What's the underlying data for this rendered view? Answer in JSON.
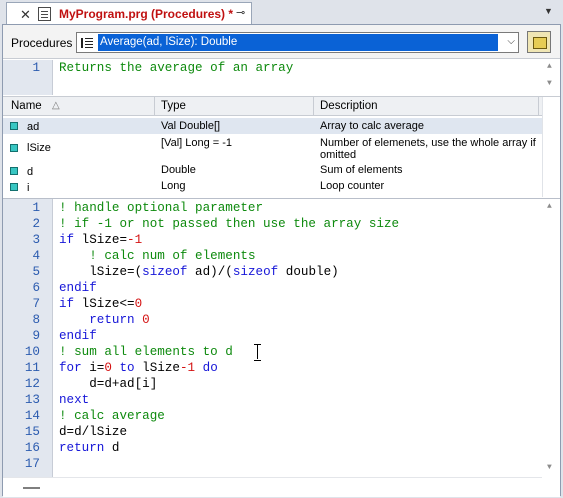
{
  "tab": {
    "close_glyph": "✕",
    "title": "MyProgram.prg (Procedures)  *",
    "pin_glyph": "⊸",
    "menu_glyph": "▼"
  },
  "procedures": {
    "label": "Procedures :",
    "selected": "Average(ad, lSize): Double",
    "dropdown_glyph": "⌵"
  },
  "description": {
    "line_number": "1",
    "text": "Returns the average of an array"
  },
  "grid": {
    "headers": [
      "Name",
      "Type",
      "Description"
    ],
    "rows": [
      {
        "name": "ad",
        "type": "Val Double[]",
        "description": "Array to calc average"
      },
      {
        "name": "lSize",
        "type": "[Val] Long = -1",
        "description": "Number of elemenets, use the whole array if omitted"
      },
      {
        "name": "d",
        "type": "Double",
        "description": "Sum of elements"
      },
      {
        "name": "i",
        "type": "Long",
        "description": "Loop counter"
      }
    ]
  },
  "code": {
    "line_numbers": [
      "1",
      "2",
      "3",
      "4",
      "5",
      "6",
      "7",
      "8",
      "9",
      "10",
      "11",
      "12",
      "13",
      "14",
      "15",
      "16",
      "17"
    ],
    "lines": [
      [
        {
          "t": "! handle optional parameter",
          "c": "cm"
        }
      ],
      [
        {
          "t": "! if -1 or not passed then use the array size",
          "c": "cm"
        }
      ],
      [
        {
          "t": "if",
          "c": "kw"
        },
        {
          "t": " lSize=",
          "c": ""
        },
        {
          "t": "-1",
          "c": "num"
        }
      ],
      [
        {
          "t": "    ",
          "c": ""
        },
        {
          "t": "! calc num of elements",
          "c": "cm"
        }
      ],
      [
        {
          "t": "    lSize=(",
          "c": ""
        },
        {
          "t": "sizeof",
          "c": "kw"
        },
        {
          "t": " ad)/(",
          "c": ""
        },
        {
          "t": "sizeof",
          "c": "kw"
        },
        {
          "t": " double)",
          "c": ""
        }
      ],
      [
        {
          "t": "endif",
          "c": "kw"
        }
      ],
      [
        {
          "t": "if",
          "c": "kw"
        },
        {
          "t": " lSize<=",
          "c": ""
        },
        {
          "t": "0",
          "c": "num"
        }
      ],
      [
        {
          "t": "    ",
          "c": ""
        },
        {
          "t": "return",
          "c": "kw"
        },
        {
          "t": " ",
          "c": ""
        },
        {
          "t": "0",
          "c": "num"
        }
      ],
      [
        {
          "t": "endif",
          "c": "kw"
        }
      ],
      [
        {
          "t": "! sum all elements to d",
          "c": "cm"
        }
      ],
      [
        {
          "t": "for",
          "c": "kw"
        },
        {
          "t": " i=",
          "c": ""
        },
        {
          "t": "0",
          "c": "num"
        },
        {
          "t": " ",
          "c": ""
        },
        {
          "t": "to",
          "c": "kw"
        },
        {
          "t": " lSize",
          "c": ""
        },
        {
          "t": "-1",
          "c": "num"
        },
        {
          "t": " ",
          "c": ""
        },
        {
          "t": "do",
          "c": "kw"
        }
      ],
      [
        {
          "t": "    d=d+ad[i]",
          "c": ""
        }
      ],
      [
        {
          "t": "next",
          "c": "kw"
        }
      ],
      [
        {
          "t": "! calc average",
          "c": "cm"
        }
      ],
      [
        {
          "t": "d=d/lSize",
          "c": ""
        }
      ],
      [
        {
          "t": "return",
          "c": "kw"
        },
        {
          "t": " d",
          "c": ""
        }
      ],
      []
    ]
  },
  "colors": {
    "keyword": "#1616d8",
    "comment": "#0e8a0e",
    "number": "#d41212",
    "line_number": "#2b5baf",
    "tab_title": "#c01010",
    "selection": "#0a62d6"
  },
  "icons": {
    "tab_doc": "document-icon",
    "combo": "procedure-list-icon",
    "button": "notebook-icon"
  }
}
